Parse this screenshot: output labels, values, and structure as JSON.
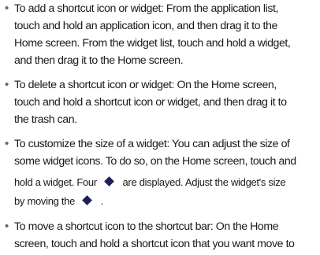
{
  "items": [
    {
      "lines": [
        "To add a shortcut icon or widget: From the application list,",
        "touch and hold an application icon, and then drag it to the",
        "Home screen. From the widget list, touch and hold a widget,",
        "and then drag it to the Home screen."
      ]
    },
    {
      "lines": [
        "To delete a shortcut icon or widget: On the Home screen,",
        "touch and hold a shortcut icon or widget, and then drag it to",
        "the trash can."
      ]
    },
    {
      "lines": [
        "To customize the size of a widget: You can adjust the size of",
        "some widget icons. To do so, on the Home screen, touch and",
        "hold a widget. Four",
        "are displayed. Adjust the widget's size",
        "by moving the",
        "."
      ]
    },
    {
      "lines": [
        "To move a shortcut icon to the shortcut bar: On the Home",
        "screen, touch and hold a shortcut icon that you want move to"
      ]
    }
  ],
  "icons": {
    "resize_handle": "diamond-icon",
    "resize_handle_color": "#1f1f5c"
  }
}
